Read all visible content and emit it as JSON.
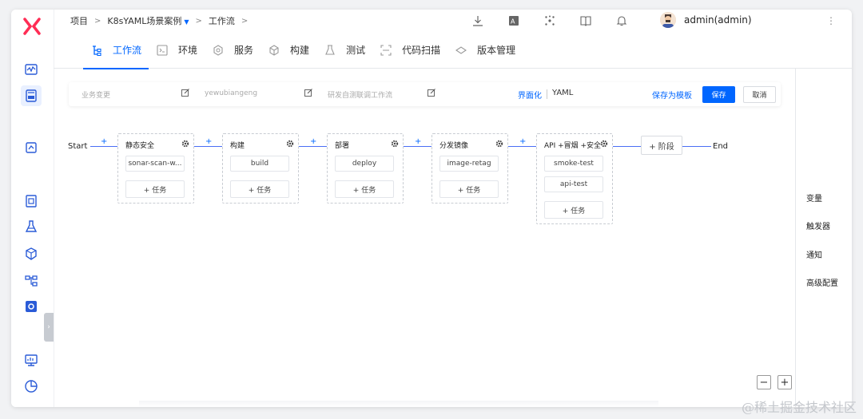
{
  "breadcrumb": {
    "project": "项目",
    "sep": ">",
    "case": "K8sYAML场景案例",
    "caret": "▼",
    "workflow": "工作流"
  },
  "user": {
    "name": "admin(admin)",
    "more": "⋮"
  },
  "tabs": [
    {
      "label": "工作流",
      "icon": "workflow-icon",
      "active": true
    },
    {
      "label": "环境",
      "icon": "environment-icon"
    },
    {
      "label": "服务",
      "icon": "service-icon"
    },
    {
      "label": "构建",
      "icon": "build-icon"
    },
    {
      "label": "测试",
      "icon": "test-icon"
    },
    {
      "label": "代码扫描",
      "icon": "code-scan-icon"
    },
    {
      "label": "版本管理",
      "icon": "version-icon"
    }
  ],
  "infobar": {
    "field1": "业务变更",
    "field2": "yewubiangeng",
    "field3": "研发自测联调工作流",
    "ui_mode": "界面化",
    "yaml_mode": "YAML",
    "save_template": "保存为模板",
    "save": "保存",
    "cancel": "取消"
  },
  "pipeline": {
    "start": "Start",
    "end": "End",
    "plus": "+",
    "add_task": "+ 任务",
    "add_stage": "+ 阶段",
    "stages": [
      {
        "title": "静态安全",
        "jobs": [
          "sonar-scan-w..."
        ]
      },
      {
        "title": "构建",
        "jobs": [
          "build"
        ]
      },
      {
        "title": "部署",
        "jobs": [
          "deploy"
        ]
      },
      {
        "title": "分发镜像",
        "jobs": [
          "image-retag"
        ]
      },
      {
        "title": "API +冒烟 +安全",
        "jobs": [
          "smoke-test",
          "api-test"
        ]
      }
    ]
  },
  "right_panel": [
    "变量",
    "触发器",
    "通知",
    "高级配置"
  ],
  "zoom": {
    "out": "−",
    "in": "+"
  },
  "watermark": "@稀土掘金技术社区",
  "colors": {
    "accent": "#0066ff",
    "logo": "#ff2d55"
  }
}
